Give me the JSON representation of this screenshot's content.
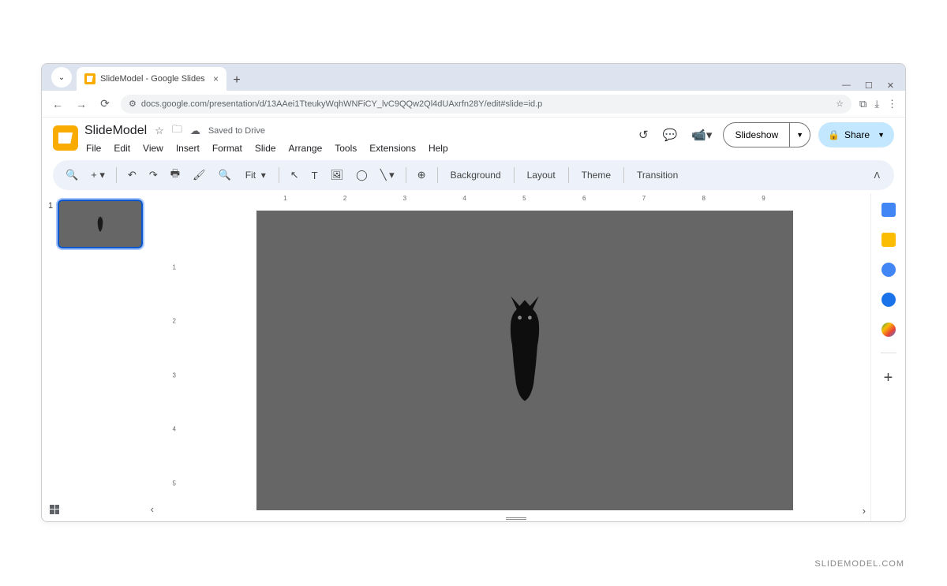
{
  "browser": {
    "tab_title": "SlideModel - Google Slides",
    "url": "docs.google.com/presentation/d/13AAei1TteukyWqhWNFiCY_lvC9QQw2Ql4dUAxrfn28Y/edit#slide=id.p"
  },
  "app": {
    "doc_title": "SlideModel",
    "save_status": "Saved to Drive",
    "menus": [
      "File",
      "Edit",
      "View",
      "Insert",
      "Format",
      "Slide",
      "Arrange",
      "Tools",
      "Extensions",
      "Help"
    ],
    "slideshow_label": "Slideshow",
    "share_label": "Share"
  },
  "toolbar": {
    "zoom_label": "Fit",
    "buttons": [
      "Background",
      "Layout",
      "Theme",
      "Transition"
    ]
  },
  "ruler": {
    "h_ticks": [
      1,
      2,
      3,
      4,
      5,
      6,
      7,
      8,
      9
    ],
    "v_ticks": [
      1,
      2,
      3,
      4,
      5
    ]
  },
  "thumbnails": {
    "current": "1"
  },
  "watermark": "SLIDEMODEL.COM"
}
